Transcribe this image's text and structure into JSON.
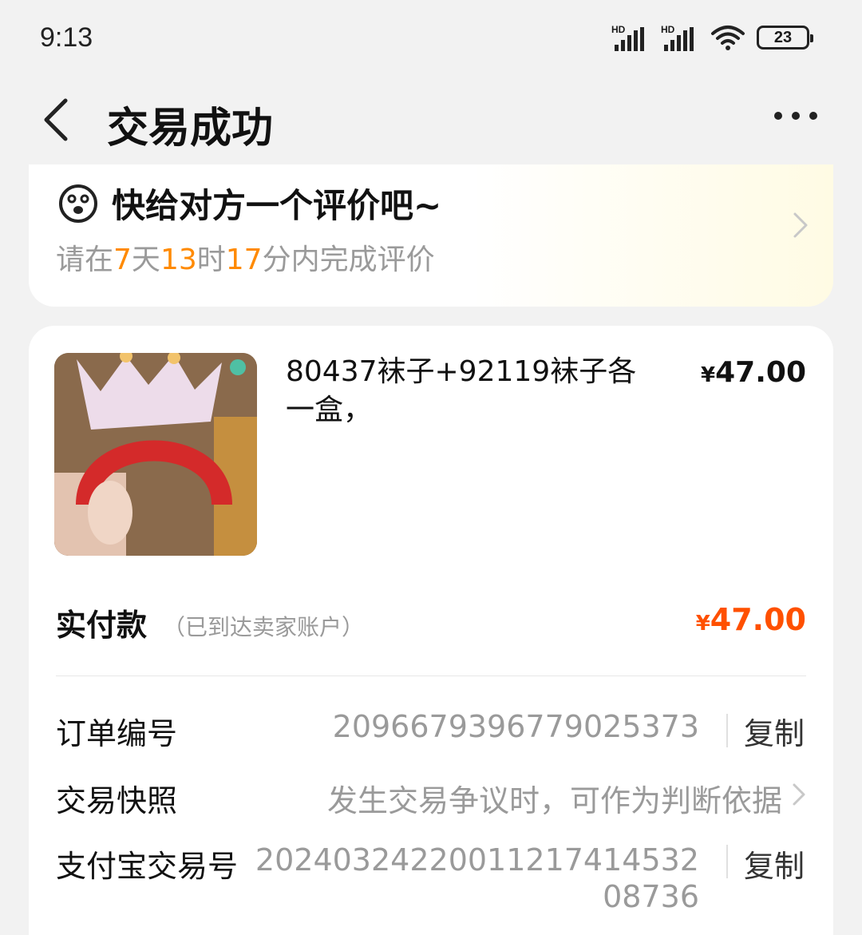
{
  "status_bar": {
    "time": "9:13",
    "signal1_label": "HD",
    "signal2_label": "HD",
    "battery": "23"
  },
  "nav": {
    "title": "交易成功"
  },
  "review": {
    "title": "快给对方一个评价吧~",
    "prefix": "请在",
    "days": "7",
    "days_unit": "天",
    "hours": "13",
    "hours_unit": "时",
    "minutes": "17",
    "suffix": "分内完成评价",
    "highlight_color": "#ff8a00"
  },
  "order": {
    "product_name": "80437袜子+92119袜子各一盒，",
    "currency": "¥",
    "product_price": "47.00",
    "paid_label": "实付款",
    "paid_note": "（已到达卖家账户）",
    "paid_amount": "47.00",
    "paid_color": "#ff5000",
    "order_no_label": "订单编号",
    "order_no": "2096679396779025373",
    "copy_label": "复制",
    "snapshot_label": "交易快照",
    "snapshot_desc": "发生交易争议时，可作为判断依据",
    "alipay_label": "支付宝交易号",
    "alipay_no_line1": "20240324220011217414532",
    "alipay_no_line2": "08736"
  }
}
